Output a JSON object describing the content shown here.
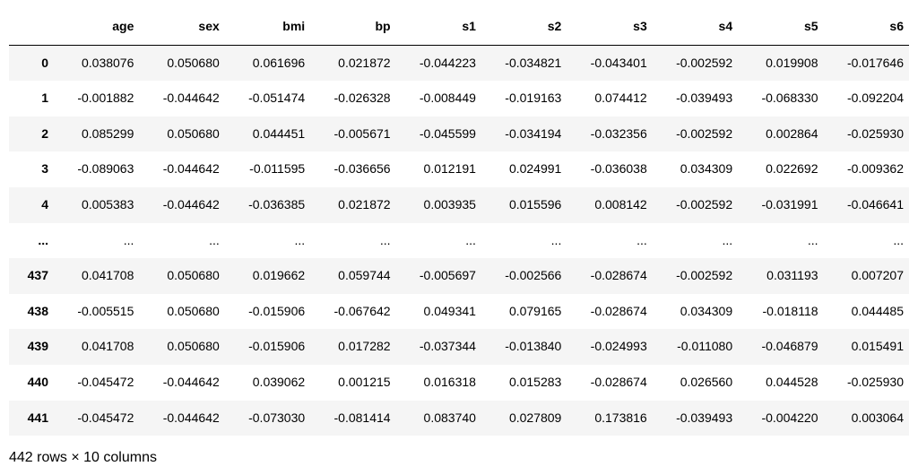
{
  "table": {
    "columns": [
      "age",
      "sex",
      "bmi",
      "bp",
      "s1",
      "s2",
      "s3",
      "s4",
      "s5",
      "s6"
    ],
    "index": [
      "0",
      "1",
      "2",
      "3",
      "4",
      "...",
      "437",
      "438",
      "439",
      "440",
      "441"
    ],
    "rows": [
      [
        "0.038076",
        "0.050680",
        "0.061696",
        "0.021872",
        "-0.044223",
        "-0.034821",
        "-0.043401",
        "-0.002592",
        "0.019908",
        "-0.017646"
      ],
      [
        "-0.001882",
        "-0.044642",
        "-0.051474",
        "-0.026328",
        "-0.008449",
        "-0.019163",
        "0.074412",
        "-0.039493",
        "-0.068330",
        "-0.092204"
      ],
      [
        "0.085299",
        "0.050680",
        "0.044451",
        "-0.005671",
        "-0.045599",
        "-0.034194",
        "-0.032356",
        "-0.002592",
        "0.002864",
        "-0.025930"
      ],
      [
        "-0.089063",
        "-0.044642",
        "-0.011595",
        "-0.036656",
        "0.012191",
        "0.024991",
        "-0.036038",
        "0.034309",
        "0.022692",
        "-0.009362"
      ],
      [
        "0.005383",
        "-0.044642",
        "-0.036385",
        "0.021872",
        "0.003935",
        "0.015596",
        "0.008142",
        "-0.002592",
        "-0.031991",
        "-0.046641"
      ],
      [
        "...",
        "...",
        "...",
        "...",
        "...",
        "...",
        "...",
        "...",
        "...",
        "..."
      ],
      [
        "0.041708",
        "0.050680",
        "0.019662",
        "0.059744",
        "-0.005697",
        "-0.002566",
        "-0.028674",
        "-0.002592",
        "0.031193",
        "0.007207"
      ],
      [
        "-0.005515",
        "0.050680",
        "-0.015906",
        "-0.067642",
        "0.049341",
        "0.079165",
        "-0.028674",
        "0.034309",
        "-0.018118",
        "0.044485"
      ],
      [
        "0.041708",
        "0.050680",
        "-0.015906",
        "0.017282",
        "-0.037344",
        "-0.013840",
        "-0.024993",
        "-0.011080",
        "-0.046879",
        "0.015491"
      ],
      [
        "-0.045472",
        "-0.044642",
        "0.039062",
        "0.001215",
        "0.016318",
        "0.015283",
        "-0.028674",
        "0.026560",
        "0.044528",
        "-0.025930"
      ],
      [
        "-0.045472",
        "-0.044642",
        "-0.073030",
        "-0.081414",
        "0.083740",
        "0.027809",
        "0.173816",
        "-0.039493",
        "-0.004220",
        "0.003064"
      ]
    ],
    "shape_text": "442 rows × 10 columns"
  }
}
